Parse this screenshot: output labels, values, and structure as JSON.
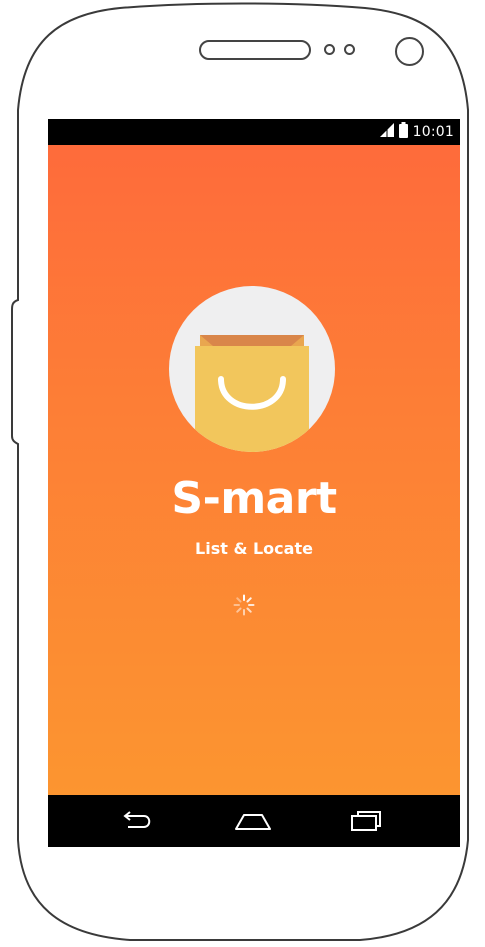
{
  "status_bar": {
    "time": "10:01",
    "signal_icon": "signal-icon",
    "battery_icon": "battery-icon"
  },
  "splash": {
    "title": "S-mart",
    "subtitle": "List & Locate",
    "logo_icon": "shopping-bag-icon",
    "loading_icon": "loading-spinner-icon",
    "colors": {
      "gradient_top": "#fe6b3b",
      "gradient_bottom": "#fc9530",
      "logo_background": "#efeff0",
      "bag_body": "#f2c65c",
      "bag_fold": "#d9864a"
    }
  },
  "nav_bar": {
    "back_icon": "back-icon",
    "home_icon": "home-icon",
    "recents_icon": "recent-apps-icon"
  }
}
